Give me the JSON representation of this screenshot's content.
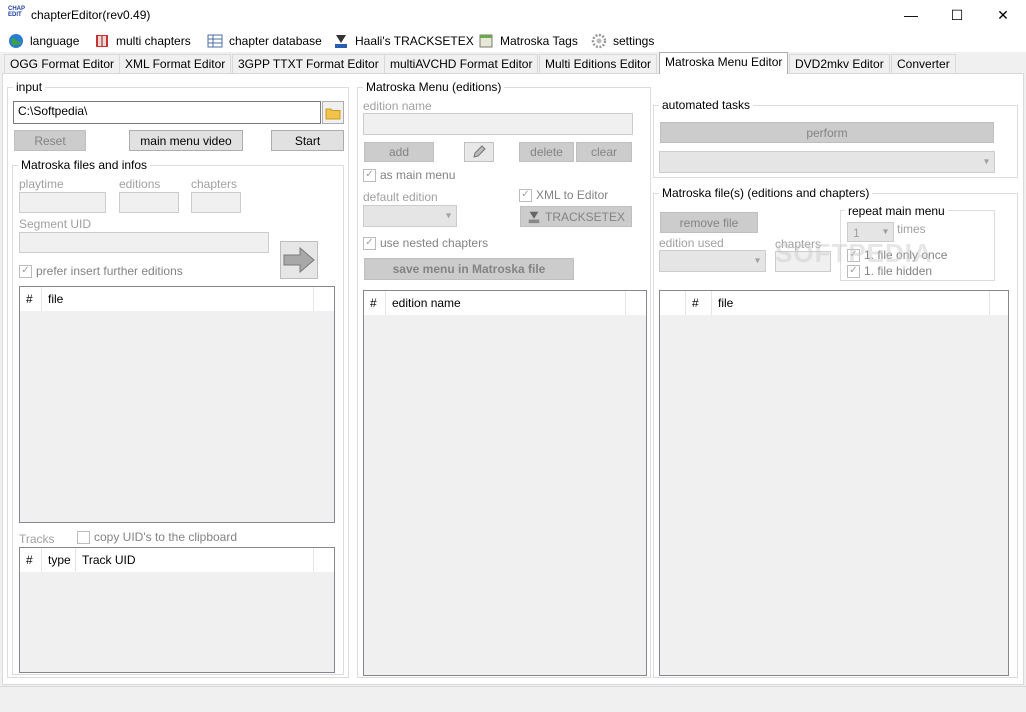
{
  "window": {
    "title": "chapterEditor(rev0.49)",
    "icon_text": "CHAP EDIT",
    "minimize_glyph": "—",
    "maximize_glyph": "☐",
    "close_glyph": "✕"
  },
  "menu": [
    {
      "label": "language",
      "icon": "globe-icon"
    },
    {
      "label": "multi chapters",
      "icon": "book-icon"
    },
    {
      "label": "chapter database",
      "icon": "database-icon"
    },
    {
      "label": "Haali's TRACKSETEX",
      "icon": "trackset-icon"
    },
    {
      "label": "Matroska Tags",
      "icon": "tags-icon"
    },
    {
      "label": "settings",
      "icon": "gear-icon"
    }
  ],
  "tabs": [
    {
      "label": "OGG Format Editor"
    },
    {
      "label": "XML Format Editor"
    },
    {
      "label": "3GPP TTXT Format Editor"
    },
    {
      "label": "multiAVCHD Format Editor"
    },
    {
      "label": "Multi Editions Editor"
    },
    {
      "label": "Matroska Menu Editor",
      "active": true
    },
    {
      "label": "DVD2mkv Editor"
    },
    {
      "label": "Converter"
    }
  ],
  "input_group": {
    "title": "input",
    "path_value": "C:\\Softpedia\\",
    "reset_label": "Reset",
    "main_menu_video_label": "main menu video",
    "start_label": "Start"
  },
  "matroska_files": {
    "title": "Matroska files and infos",
    "playtime_label": "playtime",
    "editions_label": "editions",
    "chapters_label": "chapters",
    "segment_uid_label": "Segment UID",
    "prefer_insert_label": "prefer insert further editions",
    "file_columns": [
      "#",
      "file"
    ],
    "tracks_label": "Tracks",
    "copy_uid_label": "copy UID's to the clipboard",
    "track_columns": [
      "#",
      "type",
      "Track UID"
    ]
  },
  "menu_editions": {
    "title": "Matroska Menu (editions)",
    "edition_name_label": "edition name",
    "add_label": "add",
    "delete_label": "delete",
    "clear_label": "clear",
    "as_main_menu_label": "as main menu",
    "default_edition_label": "default edition",
    "xml_to_editor_label": "XML to Editor",
    "tracksetex_label": "TRACKSETEX",
    "use_nested_label": "use nested chapters",
    "save_menu_label": "save menu in Matroska file",
    "edition_columns": [
      "#",
      "edition name"
    ]
  },
  "automated_tasks": {
    "title": "automated tasks",
    "perform_label": "perform"
  },
  "matroska_file_editions": {
    "title": "Matroska file(s) (editions and chapters)",
    "remove_file_label": "remove file",
    "edition_used_label": "edition used",
    "chapters_label": "chapters",
    "repeat_title": "repeat main menu",
    "repeat_value": "1",
    "times_label": "times",
    "file_only_once_label": "1. file only once",
    "file_hidden_label": "1. file hidden",
    "file_columns": [
      "",
      "#",
      "file"
    ]
  },
  "watermark": "SOFTPEDIA"
}
